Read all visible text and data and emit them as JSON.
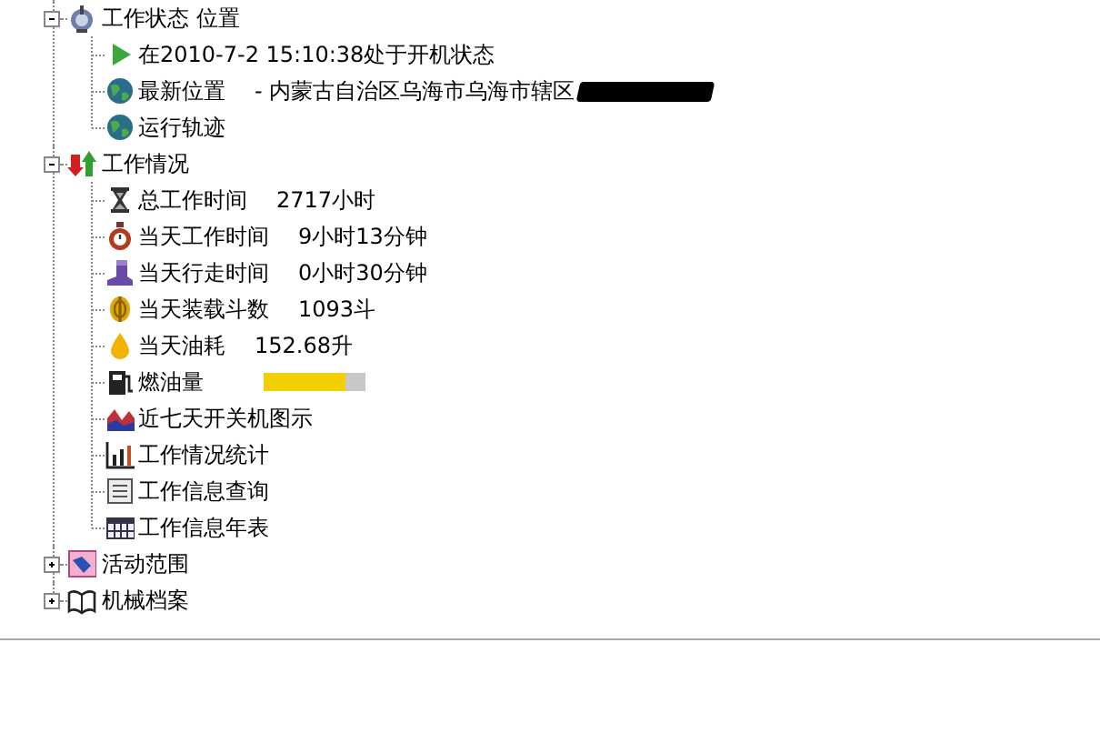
{
  "tree": [
    {
      "label": "工作状态 位置",
      "expanded": true,
      "children": [
        {
          "label": "在2010-7-2 15:10:38处于开机状态"
        },
        {
          "label": "最新位置",
          "value": "- 内蒙古自治区乌海市乌海市辖区",
          "redacted": true
        },
        {
          "label": "运行轨迹"
        }
      ]
    },
    {
      "label": "工作情况",
      "expanded": true,
      "children": [
        {
          "label": "总工作时间",
          "value": "2717小时"
        },
        {
          "label": "当天工作时间",
          "value": "9小时13分钟"
        },
        {
          "label": "当天行走时间",
          "value": "0小时30分钟"
        },
        {
          "label": "当天装载斗数",
          "value": "1093斗"
        },
        {
          "label": "当天油耗",
          "value": "152.68升"
        },
        {
          "label": "燃油量",
          "level": 0.8
        },
        {
          "label": "近七天开关机图示"
        },
        {
          "label": "工作情况统计"
        },
        {
          "label": "工作信息查询"
        },
        {
          "label": "工作信息年表"
        }
      ]
    },
    {
      "label": "活动范围",
      "expanded": false
    },
    {
      "label": "机械档案",
      "expanded": false
    }
  ]
}
